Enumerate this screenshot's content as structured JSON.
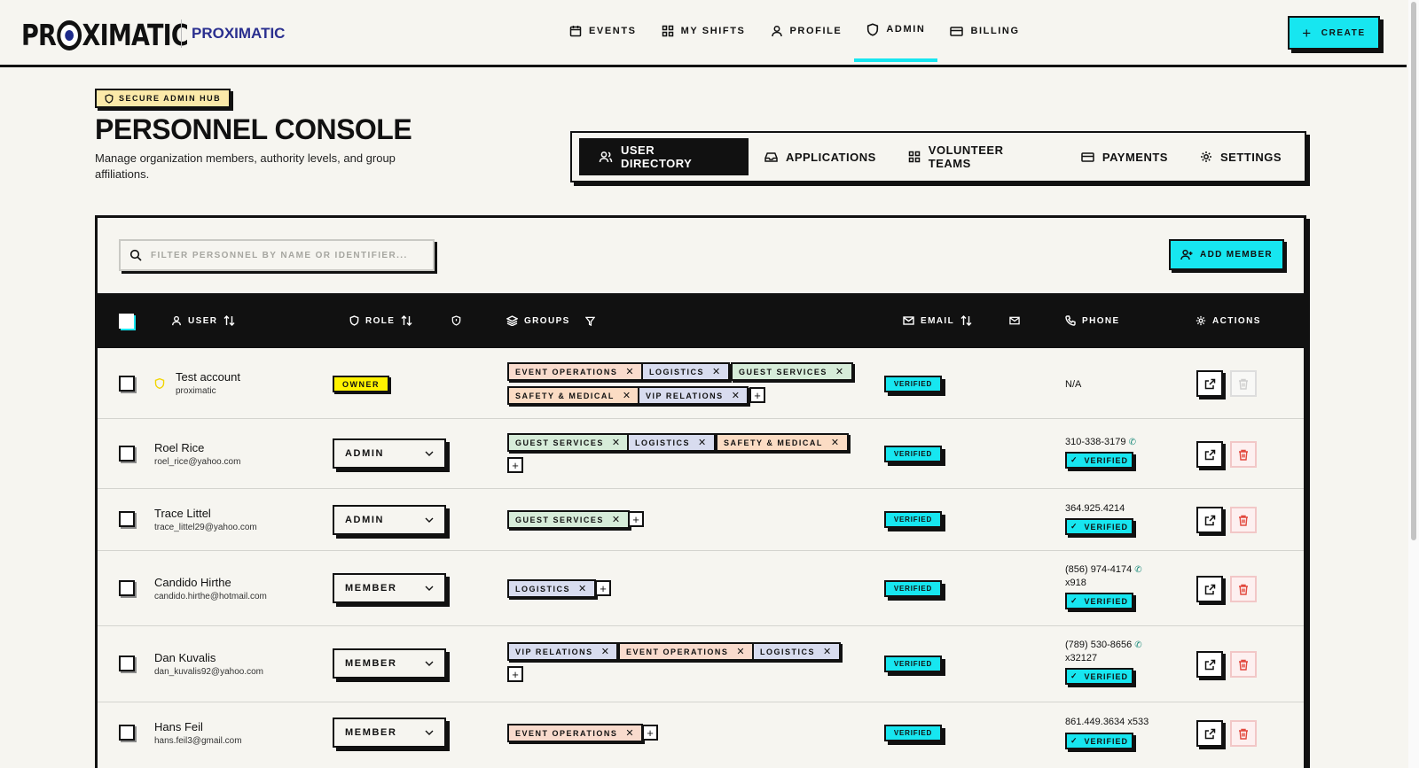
{
  "brand": {
    "logo_text_a": "PR",
    "logo_text_b": "XIMATIC",
    "name": "PROXIMATIC"
  },
  "nav": [
    {
      "label": "EVENTS",
      "icon": "calendar-icon"
    },
    {
      "label": "MY SHIFTS",
      "icon": "grid-icon"
    },
    {
      "label": "PROFILE",
      "icon": "user-icon"
    },
    {
      "label": "ADMIN",
      "icon": "shield-icon",
      "active": true
    },
    {
      "label": "BILLING",
      "icon": "credit-card-icon"
    }
  ],
  "create_label": "CREATE",
  "hub_badge": "SECURE ADMIN HUB",
  "page_title": "PERSONNEL CONSOLE",
  "page_subtitle": "Manage organization members, authority levels, and group affiliations.",
  "tabs": [
    {
      "label": "USER DIRECTORY",
      "active": true
    },
    {
      "label": "APPLICATIONS"
    },
    {
      "label": "VOLUNTEER TEAMS"
    },
    {
      "label": "PAYMENTS"
    },
    {
      "label": "SETTINGS"
    }
  ],
  "search": {
    "placeholder": "FILTER PERSONNEL BY NAME OR IDENTIFIER...",
    "value": ""
  },
  "add_member_label": "ADD MEMBER",
  "columns": {
    "user": "USER",
    "role": "ROLE",
    "groups": "GROUPS",
    "email": "EMAIL",
    "phone": "PHONE",
    "actions": "ACTIONS"
  },
  "rows": [
    {
      "name": "Test account",
      "sub": "proximatic",
      "role": "OWNER",
      "groups": [
        "EVENT OPERATIONS",
        "LOGISTICS",
        "GUEST SERVICES",
        "SAFETY & MEDICAL",
        "VIP RELATIONS"
      ],
      "email_status": "VERIFIED",
      "phone": "N/A",
      "phone_line2": "",
      "phone_verified": ""
    },
    {
      "name": "Roel Rice",
      "sub": "roel_rice@yahoo.com",
      "role": "ADMIN",
      "groups": [
        "GUEST SERVICES",
        "LOGISTICS",
        "SAFETY & MEDICAL"
      ],
      "email_status": "VERIFIED",
      "phone": "310-338-3179",
      "phone_line2": "",
      "phone_verified": "VERIFIED"
    },
    {
      "name": "Trace Littel",
      "sub": "trace_littel29@yahoo.com",
      "role": "ADMIN",
      "groups": [
        "GUEST SERVICES"
      ],
      "email_status": "VERIFIED",
      "phone": "364.925.4214",
      "phone_line2": "",
      "phone_verified": "VERIFIED"
    },
    {
      "name": "Candido Hirthe",
      "sub": "candido.hirthe@hotmail.com",
      "role": "MEMBER",
      "groups": [
        "LOGISTICS"
      ],
      "email_status": "VERIFIED",
      "phone": "(856) 974-4174",
      "phone_line2": "x918",
      "phone_verified": "VERIFIED"
    },
    {
      "name": "Dan Kuvalis",
      "sub": "dan_kuvalis92@yahoo.com",
      "role": "MEMBER",
      "groups": [
        "VIP RELATIONS",
        "EVENT OPERATIONS",
        "LOGISTICS"
      ],
      "email_status": "VERIFIED",
      "phone": "(789) 530-8656",
      "phone_line2": "x32127",
      "phone_verified": "VERIFIED"
    },
    {
      "name": "Hans Feil",
      "sub": "hans.feil3@gmail.com",
      "role": "MEMBER",
      "groups": [
        "EVENT OPERATIONS"
      ],
      "email_status": "VERIFIED",
      "phone": "861.449.3634 x533",
      "phone_line2": "",
      "phone_verified": "VERIFIED"
    }
  ],
  "colors": {
    "accent": "#17e6f0",
    "ink": "#111111",
    "background": "#f6f5f0",
    "owner": "#fff200",
    "brand_name": "#2a2f8f"
  }
}
